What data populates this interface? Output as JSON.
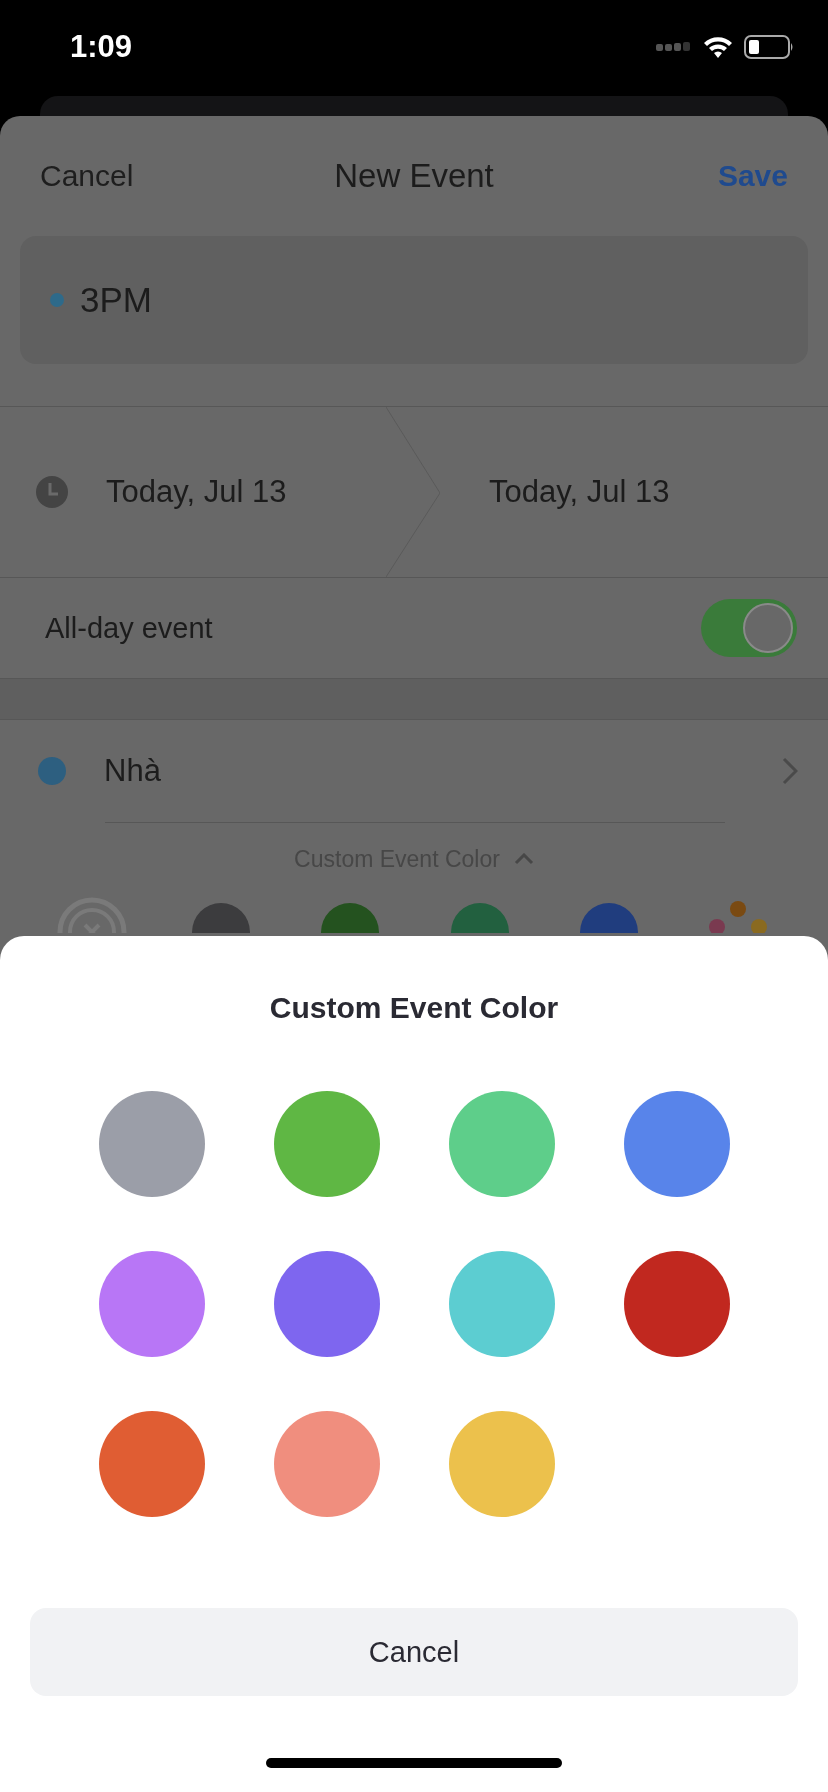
{
  "status_bar": {
    "time": "1:09"
  },
  "event_form": {
    "cancel": "Cancel",
    "title": "New Event",
    "save": "Save",
    "event_title": {
      "value": "3PM",
      "color": "#2e6a8a"
    },
    "dates": {
      "start": "Today, Jul 13",
      "end": "Today, Jul 13"
    },
    "all_day": {
      "label": "All-day event",
      "on": true
    },
    "calendar": {
      "name": "Nhà",
      "color": "#2d5f80"
    },
    "custom_color": {
      "label": "Custom Event Color",
      "expanded": true
    },
    "color_row": [
      {
        "kind": "none"
      },
      {
        "kind": "color",
        "color": "#3c3c3e"
      },
      {
        "kind": "color",
        "color": "#24521f"
      },
      {
        "kind": "color",
        "color": "#22603f"
      },
      {
        "kind": "color",
        "color": "#203d7e"
      },
      {
        "kind": "more"
      }
    ]
  },
  "color_picker": {
    "title": "Custom Event Color",
    "colors": [
      {
        "color": "#9b9ea8"
      },
      {
        "color": "#5fb744"
      },
      {
        "color": "#5ece8a"
      },
      {
        "color": "#5884ea"
      },
      {
        "color": "#b876f6"
      },
      {
        "color": "#7e66ef"
      },
      {
        "color": "#5ccdd1"
      },
      {
        "color": "#c1281f"
      },
      {
        "color": "#e05d33"
      },
      {
        "color": "#f08e7e"
      },
      {
        "color": "#ecc14c"
      }
    ],
    "cancel": "Cancel"
  }
}
